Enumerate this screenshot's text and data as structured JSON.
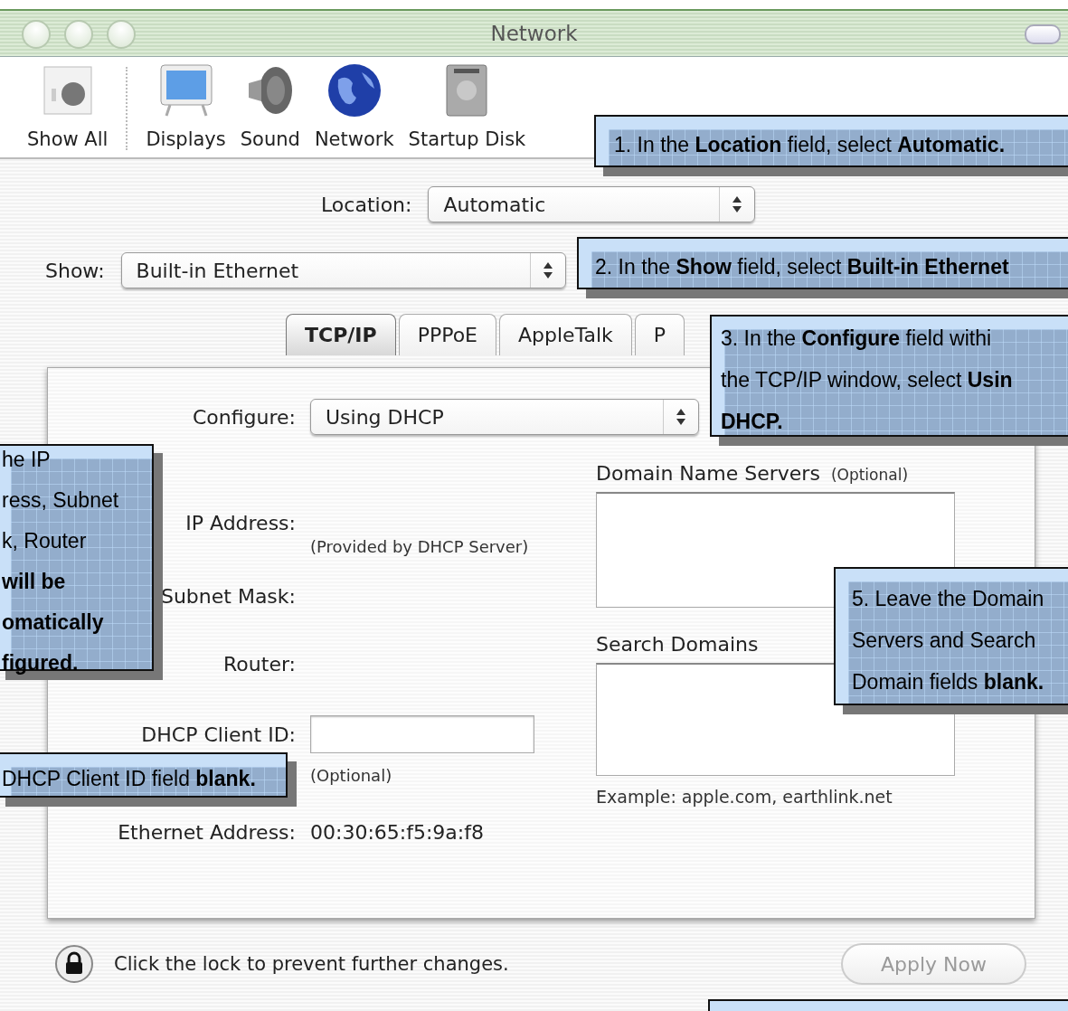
{
  "window": {
    "title": "Network"
  },
  "toolbar": {
    "items": [
      {
        "label": "Show All"
      },
      {
        "label": "Displays"
      },
      {
        "label": "Sound"
      },
      {
        "label": "Network"
      },
      {
        "label": "Startup Disk"
      }
    ]
  },
  "location": {
    "label": "Location:",
    "value": "Automatic"
  },
  "show": {
    "label": "Show:",
    "value": "Built-in Ethernet"
  },
  "tabs": [
    {
      "label": "TCP/IP",
      "selected": true
    },
    {
      "label": "PPPoE",
      "selected": false
    },
    {
      "label": "AppleTalk",
      "selected": false
    },
    {
      "label": "P",
      "selected": false
    }
  ],
  "configure": {
    "label": "Configure:",
    "value": "Using DHCP"
  },
  "ip_address": {
    "label": "IP Address:",
    "note": "(Provided by DHCP Server)"
  },
  "subnet_mask": {
    "label": "Subnet Mask:"
  },
  "router": {
    "label": "Router:"
  },
  "dhcp_client_id": {
    "label": "DHCP Client ID:",
    "note": "(Optional)"
  },
  "ethernet_address": {
    "label": "Ethernet Address:",
    "value": "00:30:65:f5:9a:f8"
  },
  "domain_name_servers": {
    "title": "Domain Name Servers",
    "note": "(Optional)"
  },
  "search_domains": {
    "title": "Search Domains",
    "example": "Example: apple.com, earthlink.net"
  },
  "lock": {
    "text": "Click the lock to prevent further changes."
  },
  "apply_button": {
    "label": "Apply Now",
    "disabled": true
  },
  "callouts": [
    {
      "lines": [
        "1. In the **Location** field, select **Automatic.**"
      ]
    },
    {
      "lines": [
        "2. In the **Show** field, select **Built-in Ethernet**"
      ]
    },
    {
      "lines": [
        "3. In the **Configure** field withi",
        "the TCP/IP window, select **Usin**",
        "**DHCP.**"
      ]
    },
    {
      "lines": [
        "he IP",
        "ress, Subnet",
        "k, Router",
        "**will be**",
        "**omatically**",
        "**figured.**"
      ]
    },
    {
      "lines": [
        "5. Leave the Domain",
        "Servers and Search",
        "Domain fields **blank.**"
      ]
    },
    {
      "lines": [
        "DHCP Client ID field **blank.**"
      ]
    }
  ]
}
